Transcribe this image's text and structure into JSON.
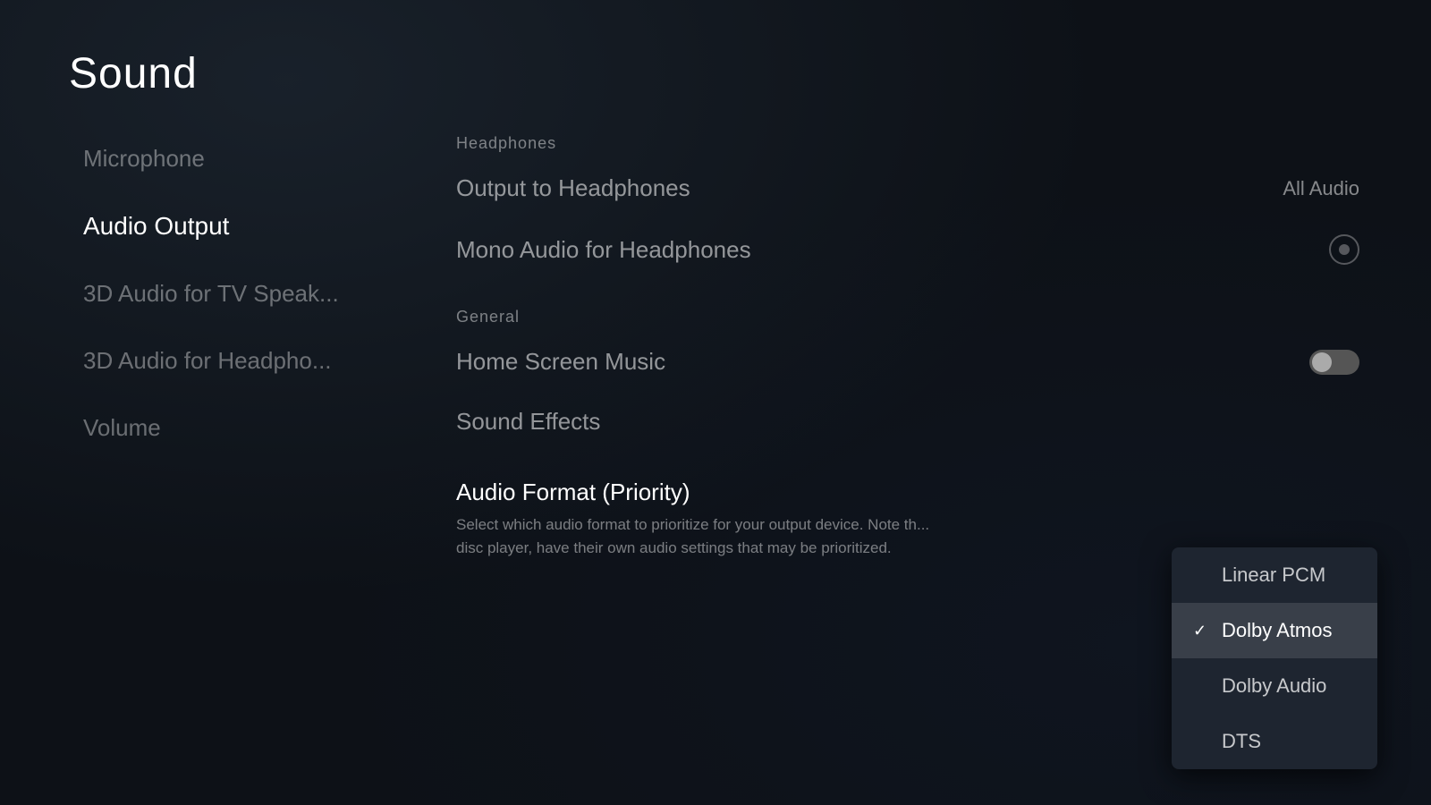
{
  "page": {
    "title": "Sound"
  },
  "sidebar": {
    "items": [
      {
        "id": "microphone",
        "label": "Microphone",
        "active": false
      },
      {
        "id": "audio-output",
        "label": "Audio Output",
        "active": true
      },
      {
        "id": "3d-tv",
        "label": "3D Audio for TV Speak...",
        "active": false
      },
      {
        "id": "3d-headphones",
        "label": "3D Audio for Headpho...",
        "active": false
      },
      {
        "id": "volume",
        "label": "Volume",
        "active": false
      }
    ]
  },
  "content": {
    "sections": [
      {
        "id": "headphones",
        "label": "Headphones",
        "settings": [
          {
            "id": "output-headphones",
            "label": "Output to Headphones",
            "value": "All Audio",
            "type": "select"
          },
          {
            "id": "mono-audio",
            "label": "Mono Audio for Headphones",
            "value": "",
            "type": "toggle-icon"
          }
        ]
      },
      {
        "id": "general",
        "label": "General",
        "settings": [
          {
            "id": "home-screen-music",
            "label": "Home Screen Music",
            "value": "",
            "type": "toggle"
          },
          {
            "id": "sound-effects",
            "label": "Sound Effects",
            "value": "",
            "type": "none"
          }
        ]
      }
    ],
    "audio_format": {
      "title": "Audio Format (Priority)",
      "description": "Select which audio format to prioritize for your output device. Note th... disc player, have their own audio settings that may be prioritized."
    }
  },
  "dropdown": {
    "items": [
      {
        "id": "linear-pcm",
        "label": "Linear PCM",
        "selected": false
      },
      {
        "id": "dolby-atmos",
        "label": "Dolby Atmos",
        "selected": true
      },
      {
        "id": "dolby-audio",
        "label": "Dolby Audio",
        "selected": false
      },
      {
        "id": "dts",
        "label": "DTS",
        "selected": false
      }
    ]
  },
  "labels": {
    "all_audio": "All Audio",
    "headphones_section": "Headphones",
    "general_section": "General",
    "output_headphones": "Output to Headphones",
    "mono_audio": "Mono Audio for Headphones",
    "home_screen_music": "Home Screen Music",
    "sound_effects": "Sound Effects",
    "audio_format_title": "Audio Format (Priority)",
    "audio_format_desc": "Select which audio format to prioritize for your output device. Note th...",
    "audio_format_desc2": "disc player, have their own audio settings that may be prioritized.",
    "linear_pcm": "Linear PCM",
    "dolby_atmos": "Dolby Atmos",
    "dolby_audio": "Dolby Audio",
    "dts": "DTS"
  }
}
